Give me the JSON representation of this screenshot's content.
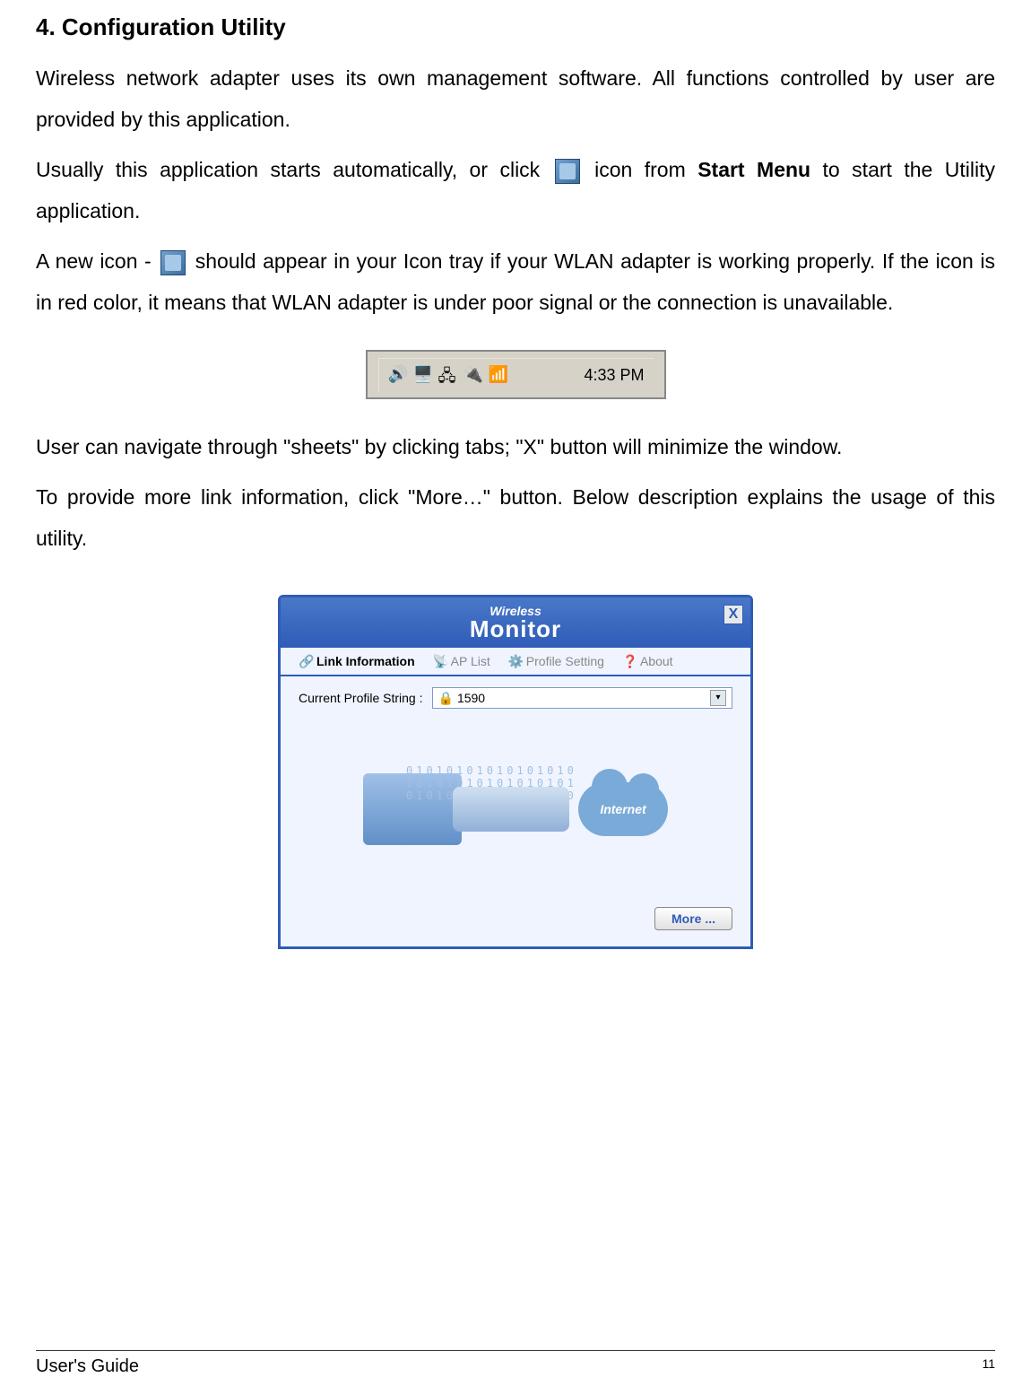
{
  "section": {
    "title": "4. Configuration Utility",
    "p1": "Wireless network adapter uses its own management software. All functions controlled by user are provided by this application.",
    "p2a": "Usually this application starts automatically, or click ",
    "p2b": " icon from ",
    "p2c": "Start Menu",
    "p2d": " to start the Utility application.",
    "p3a": "A new icon - ",
    "p3b": " should appear in your Icon tray if your WLAN adapter is working properly. If the icon is in red color, it means that WLAN adapter is under poor signal or the connection is unavailable.",
    "p4": "User can navigate through \"sheets\" by clicking tabs; \"X\" button will minimize the window.",
    "p5": "To provide more link information, click \"More…\" button. Below description explains the usage of this utility."
  },
  "systray": {
    "time": "4:33 PM"
  },
  "monitor": {
    "title_small": "Wireless",
    "title_big": "Monitor",
    "close": "X",
    "tabs": [
      {
        "label": "Link Information",
        "active": true
      },
      {
        "label": "AP List",
        "active": false
      },
      {
        "label": "Profile Setting",
        "active": false
      },
      {
        "label": "About",
        "active": false
      }
    ],
    "profile_label": "Current Profile String :",
    "profile_value": "1590",
    "internet_label": "Internet",
    "binary": "01010101010101010\n10101010101010101\n01010101010101010",
    "more_label": "More ..."
  },
  "footer": {
    "guide": "User's Guide",
    "page": "11"
  }
}
